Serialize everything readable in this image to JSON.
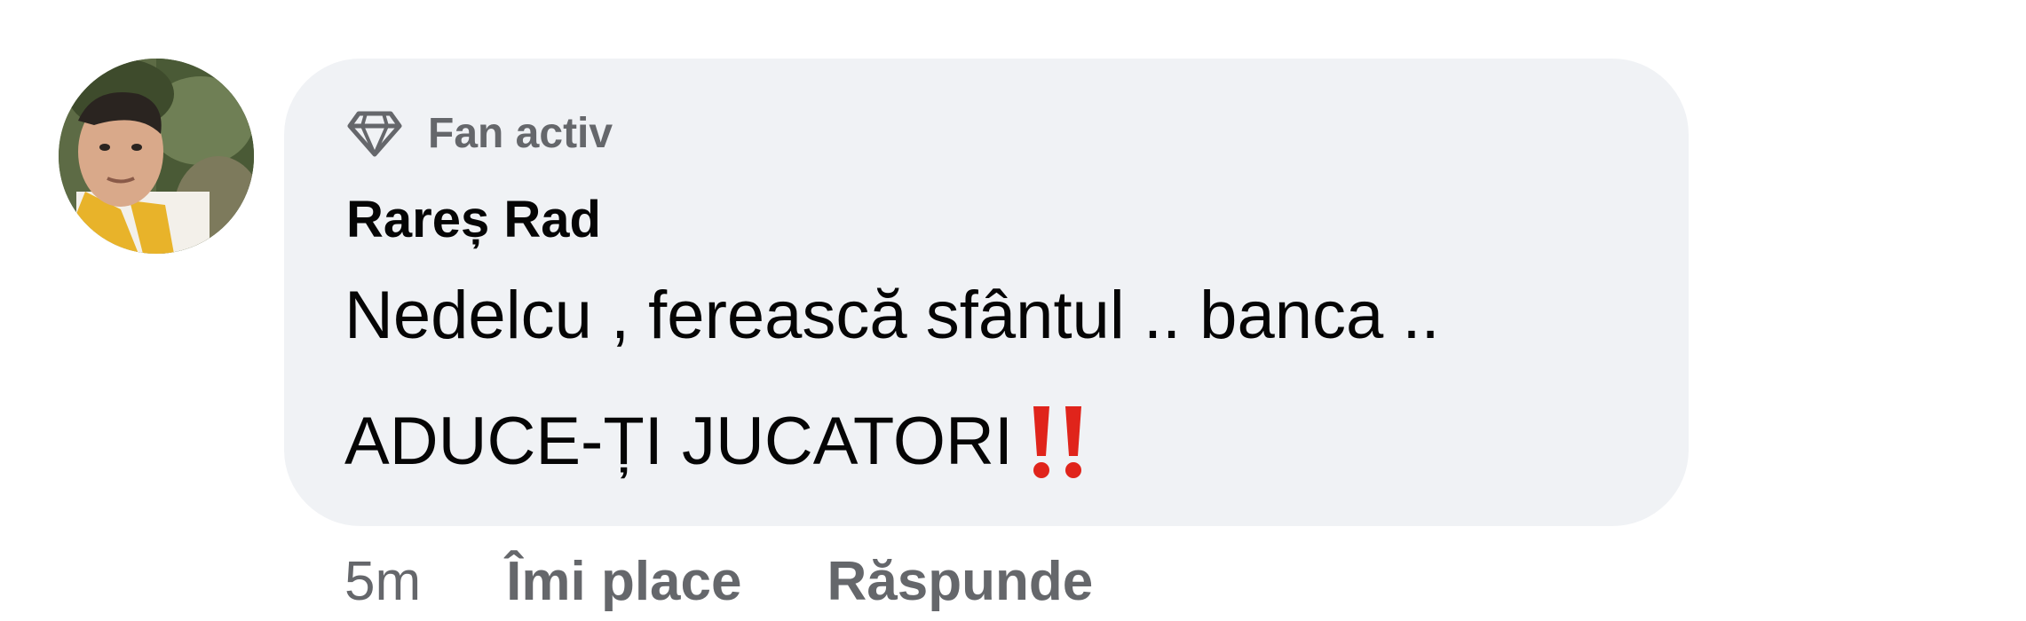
{
  "comment": {
    "badge_label": "Fan activ",
    "author": "Rareș Rad",
    "text_line1": "Nedelcu , ferească sfântul .. banca ..",
    "text_line2": "ADUCE-ȚI JUCATORI",
    "emoji": "double-exclamation-mark",
    "timestamp": "5m",
    "like_label": "Îmi place",
    "reply_label": "Răspunde"
  },
  "colors": {
    "bubble_bg": "#f0f2f5",
    "text": "#050505",
    "muted": "#65676b",
    "emoji_red": "#e0241b"
  },
  "icons": {
    "badge": "diamond-icon"
  }
}
